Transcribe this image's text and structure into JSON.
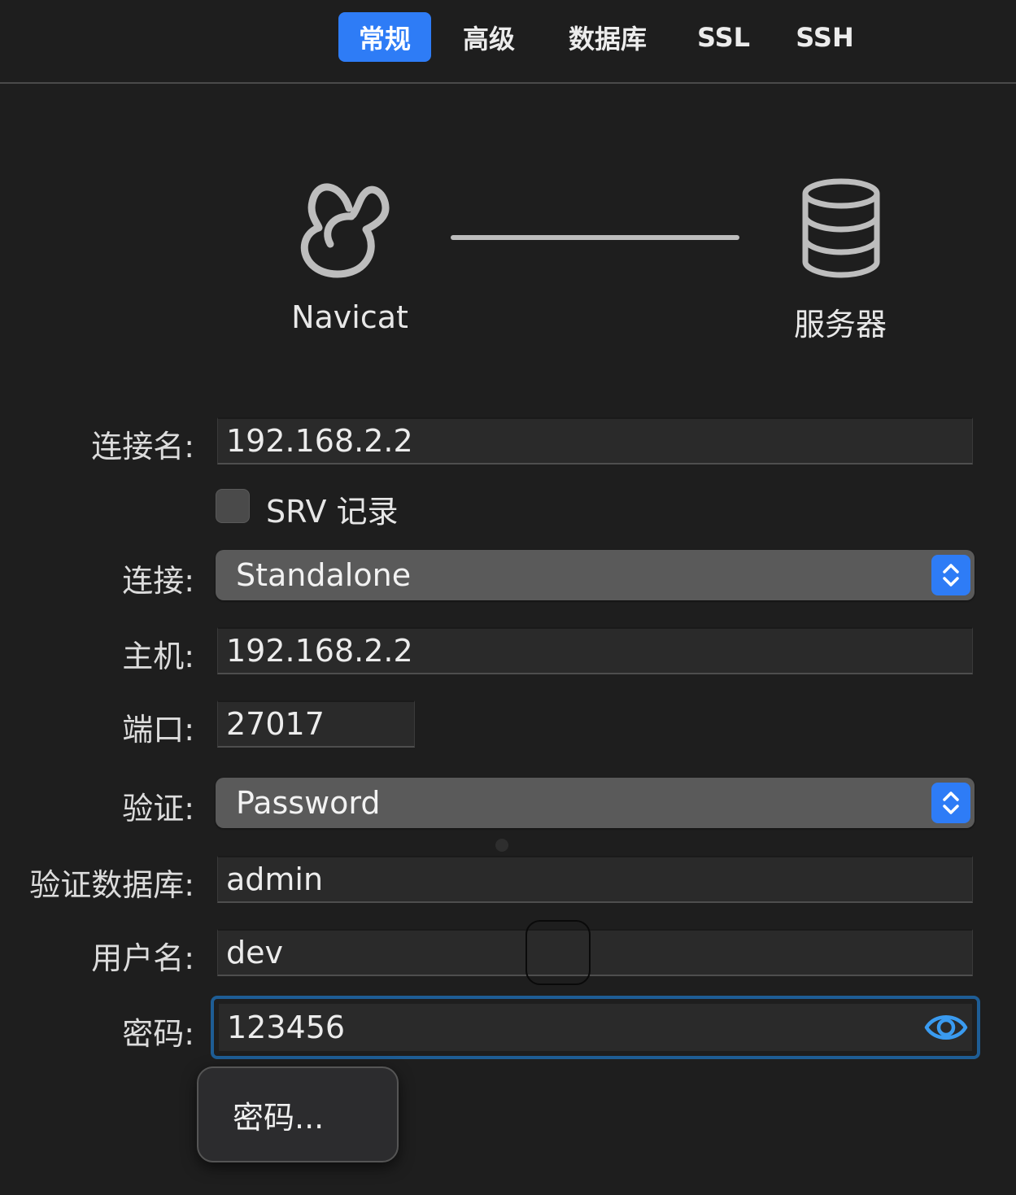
{
  "tabs": [
    {
      "label": "常规",
      "active": true
    },
    {
      "label": "高级",
      "active": false
    },
    {
      "label": "数据库",
      "active": false
    },
    {
      "label": "SSL",
      "active": false
    },
    {
      "label": "SSH",
      "active": false
    }
  ],
  "diagram": {
    "client_label": "Navicat",
    "server_label": "服务器",
    "client_icon": "navicat-logo-icon",
    "server_icon": "database-icon"
  },
  "form": {
    "connection_name": {
      "label": "连接名:",
      "value": "192.168.2.2"
    },
    "srv": {
      "label": "SRV 记录",
      "checked": false
    },
    "connection": {
      "label": "连接:",
      "value": "Standalone"
    },
    "host": {
      "label": "主机:",
      "value": "192.168.2.2"
    },
    "port": {
      "label": "端口:",
      "value": "27017"
    },
    "auth": {
      "label": "验证:",
      "value": "Password"
    },
    "auth_db": {
      "label": "验证数据库:",
      "value": "admin"
    },
    "username": {
      "label": "用户名:",
      "value": "dev"
    },
    "password": {
      "label": "密码:",
      "value": "123456",
      "icon": "eye-icon"
    }
  },
  "popup": {
    "item_label": "密码..."
  },
  "colors": {
    "accent": "#2e7cf6",
    "background": "#1e1e1e",
    "focus_ring": "#1e5d95"
  }
}
